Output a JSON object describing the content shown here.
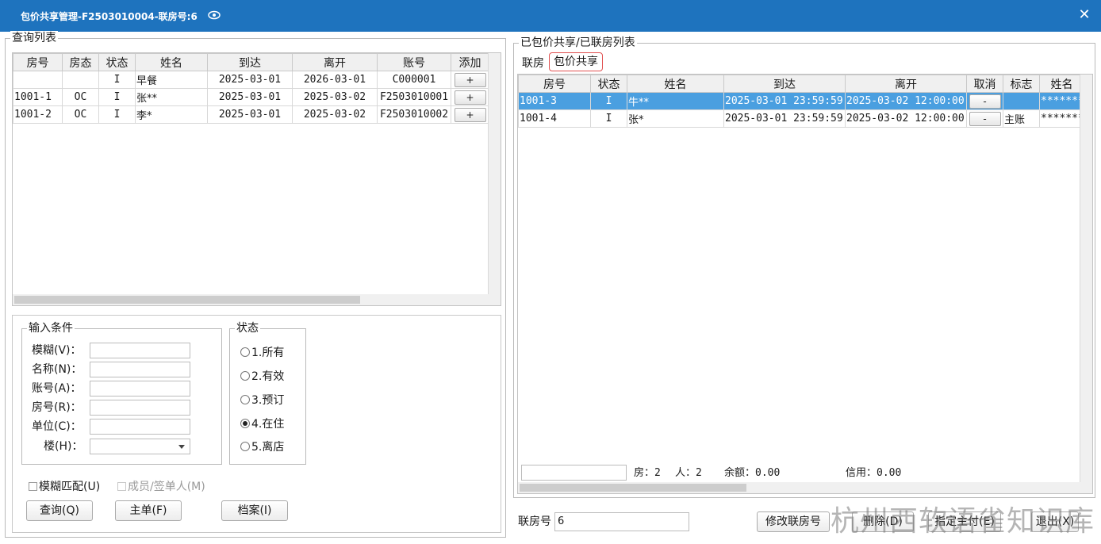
{
  "window": {
    "title": "包价共享管理-F2503010004-联房号:6",
    "close_glyph": "✕"
  },
  "query_list": {
    "legend": "查询列表",
    "columns": [
      "房号",
      "房态",
      "状态",
      "姓名",
      "到达",
      "离开",
      "账号",
      "添加"
    ],
    "rows": [
      {
        "room": "",
        "room_status": "",
        "status": "I",
        "name": "早餐",
        "arrive": "2025-03-01",
        "depart": "2026-03-01",
        "account": "C000001",
        "add": "+"
      },
      {
        "room": "1001-1",
        "room_status": "OC",
        "status": "I",
        "name": "张**",
        "arrive": "2025-03-01",
        "depart": "2025-03-02",
        "account": "F2503010001",
        "add": "+"
      },
      {
        "room": "1001-2",
        "room_status": "OC",
        "status": "I",
        "name": "李*",
        "arrive": "2025-03-01",
        "depart": "2025-03-02",
        "account": "F2503010002",
        "add": "+"
      }
    ]
  },
  "conditions": {
    "legend": "输入条件",
    "fuzzy_label": "模糊(V)：",
    "name_label": "名称(N)：",
    "account_label": "账号(A)：",
    "room_label": "房号(R)：",
    "unit_label": "单位(C)：",
    "building_label": "楼(H)：",
    "fuzzy_value": "",
    "name_value": "",
    "account_value": "",
    "room_value": "",
    "unit_value": "",
    "building_value": ""
  },
  "status_group": {
    "legend": "状态",
    "options": [
      "1.所有",
      "2.有效",
      "3.预订",
      "4.在住",
      "5.离店"
    ],
    "selected_index": 3
  },
  "checks": {
    "fuzzy_match": "模糊匹配(U)",
    "member_signer": "成员/签单人(M)"
  },
  "buttons": {
    "query": "查询(Q)",
    "main": "主单(F)",
    "profile": "档案(I)",
    "modify_link": "修改联房号",
    "delete": "删除(D)",
    "assign": "指定主付(E)",
    "exit": "退出(X)"
  },
  "shared_list": {
    "legend": "已包价共享/已联房列表",
    "tabs": [
      "联房",
      "包价共享"
    ],
    "active_tab": 1,
    "columns": [
      "房号",
      "状态",
      "姓名",
      "到达",
      "离开",
      "取消",
      "标志",
      "姓名"
    ],
    "rows": [
      {
        "room": "1001-3",
        "status": "I",
        "name": "牛**",
        "arrive": "2025-03-01 23:59:59",
        "depart": "2025-03-02 12:00:00",
        "cancel": "-",
        "flag": "",
        "name2": "*******",
        "selected": true
      },
      {
        "room": "1001-4",
        "status": "I",
        "name": "张*",
        "arrive": "2025-03-01 23:59:59",
        "depart": "2025-03-02 12:00:00",
        "cancel": "-",
        "flag": "主账",
        "name2": "*******",
        "selected": false
      }
    ],
    "summary": {
      "rooms": "房：2",
      "persons": "人：2",
      "balance": "余额：0.00",
      "credit": "信用：0.00"
    }
  },
  "link_no": {
    "label": "联房号",
    "value": "6"
  },
  "watermark": "杭州西软语雀知识库",
  "colors": {
    "titlebar": "#1e73be",
    "selected_row": "#4a9fe0",
    "active_tab_border": "#e05050"
  }
}
